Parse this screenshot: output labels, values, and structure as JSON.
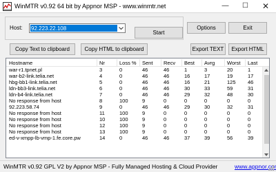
{
  "window": {
    "title": "WinMTR v0.92 64 bit by Appnor MSP - www.winmtr.net",
    "minimize_glyph": "—",
    "maximize_glyph": "☐",
    "close_glyph": "✕"
  },
  "host": {
    "label": "Host:",
    "value": "92.223.22.108"
  },
  "buttons": {
    "start": "Start",
    "options": "Options",
    "exit": "Exit",
    "copy_text": "Copy Text to clipboard",
    "copy_html": "Copy HTML to clipboard",
    "export_text": "Export TEXT",
    "export_html": "Export HTML"
  },
  "table": {
    "columns": [
      "Hostname",
      "Nr",
      "Loss %",
      "Sent",
      "Recv",
      "Best",
      "Avrg",
      "Worst",
      "Last"
    ],
    "rows": [
      [
        "war-r1.tpnet.pl",
        "3",
        "0",
        "46",
        "46",
        "1",
        "3",
        "20",
        "1"
      ],
      [
        "war-b2-link.telia.net",
        "4",
        "0",
        "46",
        "46",
        "16",
        "17",
        "19",
        "17"
      ],
      [
        "hbg-bb1-link.telia.net",
        "5",
        "0",
        "46",
        "46",
        "16",
        "21",
        "125",
        "46"
      ],
      [
        "ldn-bb3-link.telia.net",
        "6",
        "0",
        "46",
        "46",
        "30",
        "33",
        "59",
        "31"
      ],
      [
        "ldn-b4-link.telia.net",
        "7",
        "0",
        "46",
        "46",
        "29",
        "32",
        "48",
        "30"
      ],
      [
        "No response from host",
        "8",
        "100",
        "9",
        "0",
        "0",
        "0",
        "0",
        "0"
      ],
      [
        "92.223.58.74",
        "9",
        "0",
        "46",
        "46",
        "29",
        "30",
        "32",
        "31"
      ],
      [
        "No response from host",
        "11",
        "100",
        "9",
        "0",
        "0",
        "0",
        "0",
        "0"
      ],
      [
        "No response from host",
        "10",
        "100",
        "9",
        "0",
        "0",
        "0",
        "0",
        "0"
      ],
      [
        "No response from host",
        "12",
        "100",
        "9",
        "0",
        "0",
        "0",
        "0",
        "0"
      ],
      [
        "No response from host",
        "13",
        "100",
        "9",
        "0",
        "0",
        "0",
        "0",
        "0"
      ],
      [
        "ed-v-xmpp-lb-vmp-1.fe.core.pw",
        "14",
        "0",
        "46",
        "46",
        "37",
        "39",
        "56",
        "39"
      ]
    ]
  },
  "status": {
    "text": "WinMTR v0.92 GPL V2 by Appnor MSP - Fully Managed Hosting & Cloud Provider",
    "link": "www.appnor.com"
  },
  "icons": {
    "app": "winmtr-app-icon",
    "combo_arrow": "chevron-down-icon",
    "scroll_up": "triangle-up-icon",
    "scroll_down": "triangle-down-icon",
    "resize_grip": "resize-grip-icon"
  },
  "colors": {
    "selection": "#0078d7",
    "link": "#0000ee",
    "button_face": "#e1e1e1",
    "window_bg": "#f0f0f0"
  }
}
